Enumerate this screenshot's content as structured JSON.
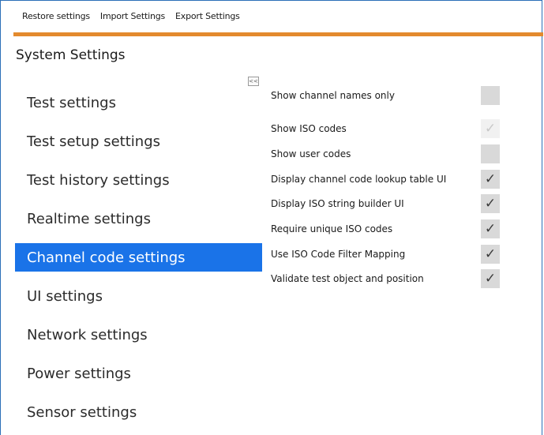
{
  "menu": [
    "Restore settings",
    "Import Settings",
    "Export Settings"
  ],
  "title": "System Settings",
  "collapse_label": "<<",
  "nav": [
    {
      "label": "Test settings",
      "active": false
    },
    {
      "label": "Test setup settings",
      "active": false
    },
    {
      "label": "Test history settings",
      "active": false
    },
    {
      "label": "Realtime settings",
      "active": false
    },
    {
      "label": "Channel code settings",
      "active": true
    },
    {
      "label": "UI settings",
      "active": false
    },
    {
      "label": "Network settings",
      "active": false
    },
    {
      "label": "Power settings",
      "active": false
    },
    {
      "label": "Sensor settings",
      "active": false
    }
  ],
  "settings": [
    {
      "label": "Show channel names only",
      "checked": false,
      "enabled": true
    },
    {
      "label": "Show ISO codes",
      "checked": true,
      "enabled": false
    },
    {
      "label": "Show user codes",
      "checked": false,
      "enabled": true
    },
    {
      "label": "Display channel code lookup table UI",
      "checked": true,
      "enabled": true
    },
    {
      "label": "Display ISO string builder UI",
      "checked": true,
      "enabled": true
    },
    {
      "label": "Require unique ISO codes",
      "checked": true,
      "enabled": true
    },
    {
      "label": "Use ISO Code Filter Mapping",
      "checked": true,
      "enabled": true
    },
    {
      "label": "Validate test object and position",
      "checked": true,
      "enabled": true
    }
  ],
  "check_glyph": "✓",
  "colors": {
    "accent": "#e38a2e",
    "selected": "#1a73e8",
    "border": "#2b6fb8"
  }
}
